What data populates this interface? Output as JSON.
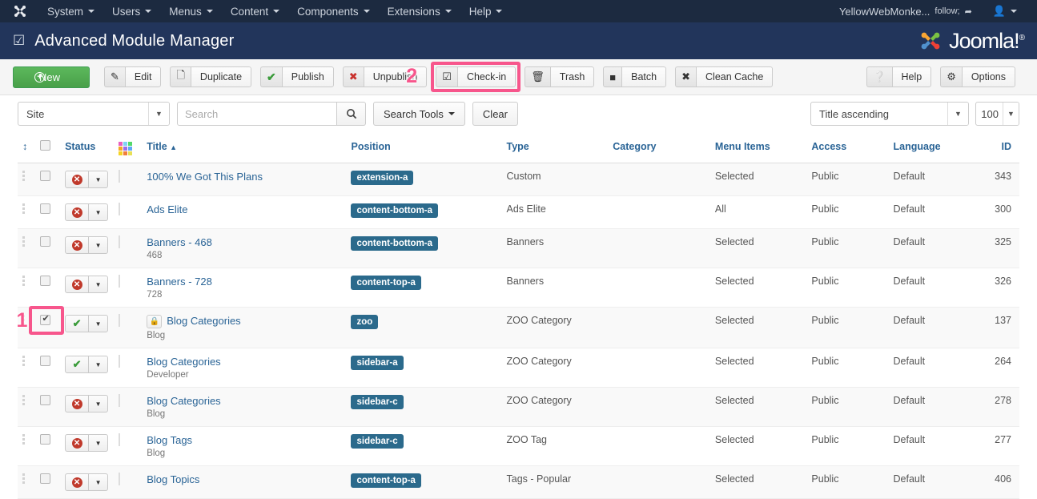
{
  "topnav": {
    "logo_icon": "joomla-brand-icon",
    "items": [
      {
        "label": "System",
        "caret": true
      },
      {
        "label": "Users",
        "caret": true
      },
      {
        "label": "Menus",
        "caret": true
      },
      {
        "label": "Content",
        "caret": true
      },
      {
        "label": "Components",
        "caret": true
      },
      {
        "label": "Extensions",
        "caret": true
      },
      {
        "label": "Help",
        "caret": true
      }
    ],
    "site_name": "YellowWebMonke...",
    "external_icon": "external-link-icon",
    "user_icon": "user-icon"
  },
  "header": {
    "check_icon": "checkbox-square-icon",
    "title": "Advanced Module Manager",
    "brand": "Joomla!",
    "brand_sup": "®"
  },
  "toolbar": {
    "new_label": "New",
    "new_icon": "plus-circle-icon",
    "buttons": [
      {
        "label": "Edit",
        "icon": "pencil-square-icon"
      },
      {
        "label": "Duplicate",
        "icon": "copy-icon"
      },
      {
        "label": "Publish",
        "icon": "check-icon"
      },
      {
        "label": "Unpublish",
        "icon": "x-circle-icon"
      },
      {
        "label": "Check-in",
        "icon": "checkbox-checked-icon"
      },
      {
        "label": "Trash",
        "icon": "trash-icon"
      },
      {
        "label": "Batch",
        "icon": "square-stack-icon"
      },
      {
        "label": "Clean Cache",
        "icon": "broom-icon"
      }
    ],
    "right_buttons": [
      {
        "label": "Help",
        "icon": "question-circle-icon"
      },
      {
        "label": "Options",
        "icon": "gear-icon"
      }
    ]
  },
  "annotations": [
    {
      "number": "2",
      "target": "unpublish-button"
    },
    {
      "number": "1",
      "target": "row-checkbox"
    }
  ],
  "filters": {
    "site_select": "Site",
    "search_placeholder": "Search",
    "search_value": "",
    "search_icon": "magnifier-icon",
    "search_tools_label": "Search Tools",
    "clear_label": "Clear",
    "sort_select": "Title ascending",
    "limit_select": "100"
  },
  "table": {
    "headers": {
      "ordering": "ordering-icon",
      "checkall": "select-all-checkbox",
      "status": "Status",
      "thumbnail": "color-grid-icon",
      "title": "Title",
      "title_sort_arrow": "▲",
      "position": "Position",
      "type": "Type",
      "category": "Category",
      "menu_items": "Menu Items",
      "access": "Access",
      "language": "Language",
      "id": "ID"
    },
    "rows": [
      {
        "checked": false,
        "status": "unpublished",
        "locked": false,
        "title": "100% We Got This Plans",
        "subtitle": "",
        "position": "extension-a",
        "type": "Custom",
        "category": "",
        "menu_items": "Selected",
        "access": "Public",
        "language": "Default",
        "id": "343"
      },
      {
        "checked": false,
        "status": "unpublished",
        "locked": false,
        "title": "Ads Elite",
        "subtitle": "",
        "position": "content-bottom-a",
        "type": "Ads Elite",
        "category": "",
        "menu_items": "All",
        "access": "Public",
        "language": "Default",
        "id": "300"
      },
      {
        "checked": false,
        "status": "unpublished",
        "locked": false,
        "title": "Banners - 468",
        "subtitle": "468",
        "position": "content-bottom-a",
        "type": "Banners",
        "category": "",
        "menu_items": "Selected",
        "access": "Public",
        "language": "Default",
        "id": "325"
      },
      {
        "checked": false,
        "status": "unpublished",
        "locked": false,
        "title": "Banners - 728",
        "subtitle": "728",
        "position": "content-top-a",
        "type": "Banners",
        "category": "",
        "menu_items": "Selected",
        "access": "Public",
        "language": "Default",
        "id": "326"
      },
      {
        "checked": true,
        "status": "published",
        "locked": true,
        "title": "Blog Categories",
        "subtitle": "Blog",
        "position": "zoo",
        "type": "ZOO Category",
        "category": "",
        "menu_items": "Selected",
        "access": "Public",
        "language": "Default",
        "id": "137"
      },
      {
        "checked": false,
        "status": "published",
        "locked": false,
        "title": "Blog Categories",
        "subtitle": "Developer",
        "position": "sidebar-a",
        "type": "ZOO Category",
        "category": "",
        "menu_items": "Selected",
        "access": "Public",
        "language": "Default",
        "id": "264"
      },
      {
        "checked": false,
        "status": "unpublished",
        "locked": false,
        "title": "Blog Categories",
        "subtitle": "Blog",
        "position": "sidebar-c",
        "type": "ZOO Category",
        "category": "",
        "menu_items": "Selected",
        "access": "Public",
        "language": "Default",
        "id": "278"
      },
      {
        "checked": false,
        "status": "unpublished",
        "locked": false,
        "title": "Blog Tags",
        "subtitle": "Blog",
        "position": "sidebar-c",
        "type": "ZOO Tag",
        "category": "",
        "menu_items": "Selected",
        "access": "Public",
        "language": "Default",
        "id": "277"
      },
      {
        "checked": false,
        "status": "unpublished",
        "locked": false,
        "title": "Blog Topics",
        "subtitle": "",
        "position": "content-top-a",
        "type": "Tags - Popular",
        "category": "",
        "menu_items": "Selected",
        "access": "Public",
        "language": "Default",
        "id": "406"
      }
    ]
  },
  "colors": {
    "topnav_bg": "#1c2a40",
    "header_bg": "#22355b",
    "new_button": "#49a049",
    "link": "#2a6496",
    "badge": "#2b6a8c",
    "annotation": "#f7568c",
    "status_unpublished": "#c0392b",
    "status_published": "#3a9b3a"
  }
}
